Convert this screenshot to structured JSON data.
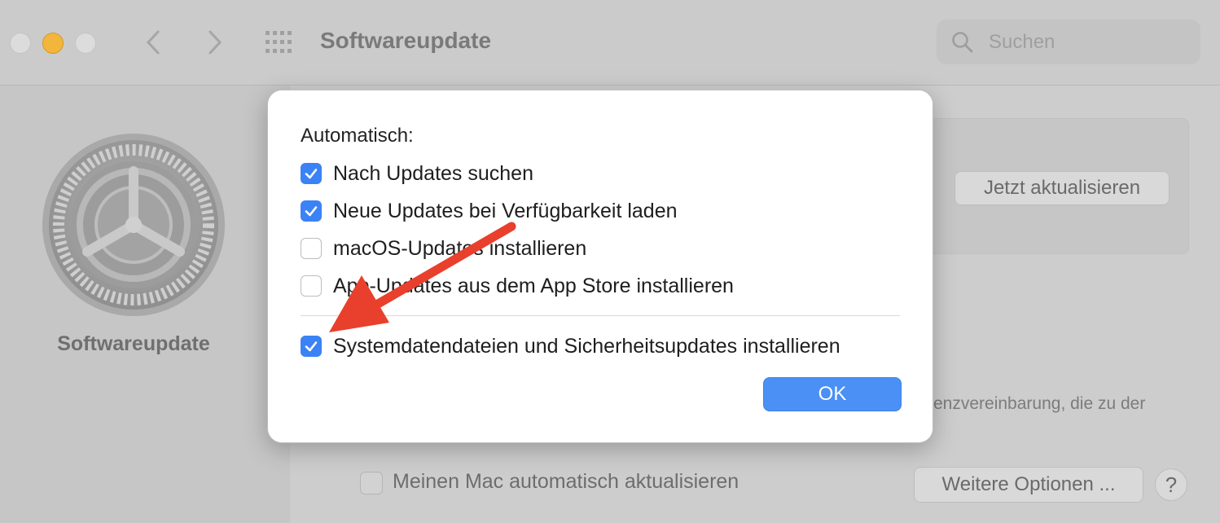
{
  "window": {
    "title": "Softwareupdate",
    "search_placeholder": "Suchen"
  },
  "sidebar": {
    "label": "Softwareupdate"
  },
  "main": {
    "update_now_label": "Jetzt aktualisieren",
    "license_text": "enzvereinbarung, die zu der",
    "auto_update_label": "Meinen Mac automatisch aktualisieren",
    "more_options_label": "Weitere Optionen ...",
    "help_label": "?"
  },
  "dialog": {
    "heading": "Automatisch:",
    "options": [
      {
        "label": "Nach Updates suchen",
        "checked": true
      },
      {
        "label": "Neue Updates bei Verfügbarkeit laden",
        "checked": true
      },
      {
        "label": "macOS-Updates installieren",
        "checked": false
      },
      {
        "label": "App-Updates aus dem App Store installieren",
        "checked": false
      },
      {
        "label": "Systemdatendateien und Sicherheitsupdates installieren",
        "checked": true
      }
    ],
    "ok_label": "OK"
  },
  "colors": {
    "accent": "#3b82f6",
    "annotation_arrow": "#e8402c"
  },
  "icons": [
    "search-icon",
    "back-chevron-icon",
    "forward-chevron-icon",
    "grid-icon",
    "gear-icon",
    "checkmark-icon",
    "red-arrow-annotation"
  ]
}
